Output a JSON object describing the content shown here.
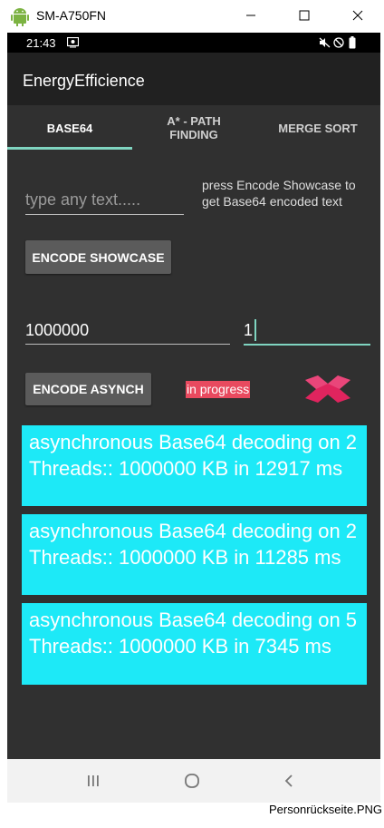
{
  "window": {
    "title": "SM-A750FN",
    "controls": [
      "minimize-icon",
      "maximize-icon",
      "close-icon"
    ]
  },
  "statusbar": {
    "time": "21:43",
    "icons": [
      "screen-record-icon",
      "mute-icon",
      "no-disturb-icon",
      "battery-icon"
    ]
  },
  "app": {
    "title": "EnergyEfficience"
  },
  "tabs": [
    {
      "label": "BASE64",
      "active": true
    },
    {
      "label": "A* - PATH\nFINDING",
      "active": false
    },
    {
      "label": "MERGE SORT",
      "active": false
    }
  ],
  "base64": {
    "text_input": {
      "value": "",
      "placeholder": "type any text....."
    },
    "hint": "press Encode Showcase to get Base64 encoded text",
    "encode_showcase_label": "ENCODE SHOWCASE",
    "size_input": "1000000",
    "threads_input": "1",
    "encode_async_label": "ENCODE ASYNCH",
    "progress_text": "in progress",
    "progress_color": "#e84a5f",
    "cancel_icon": "close-x-icon"
  },
  "results": [
    {
      "text": "asynchronous Base64 decoding on 2 Threads:: 1000000 KB in 12917 ms"
    },
    {
      "text": "asynchronous Base64 decoding on 2 Threads:: 1000000 KB in 11285 ms"
    },
    {
      "text": "asynchronous Base64 decoding on 5 Threads:: 1000000 KB in 7345 ms"
    }
  ],
  "navbar": {
    "buttons": [
      "recents-icon",
      "home-icon",
      "back-icon"
    ]
  },
  "file_label": "Personrückseite.PNG"
}
